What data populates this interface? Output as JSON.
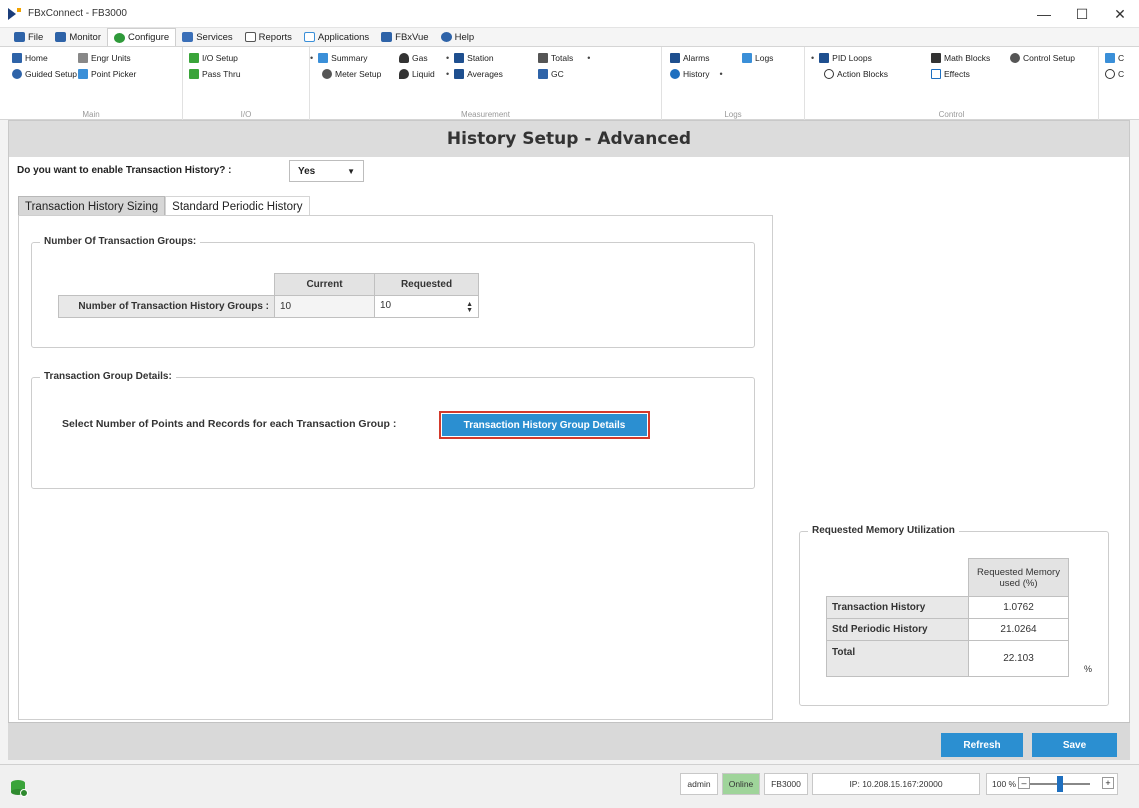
{
  "window": {
    "title": "FBxConnect - FB3000"
  },
  "menu": {
    "tabs": [
      {
        "label": "File",
        "color": "#2e63a8"
      },
      {
        "label": "Monitor",
        "color": "#2e63a8"
      },
      {
        "label": "Configure",
        "color": "#2f9a3a"
      },
      {
        "label": "Services",
        "color": "#3a6fb8"
      },
      {
        "label": "Reports",
        "color": "#555555"
      },
      {
        "label": "Applications",
        "color": "#3a8fd8"
      },
      {
        "label": "FBxVue",
        "color": "#2e63a8"
      },
      {
        "label": "Help",
        "color": "#2e63a8"
      }
    ],
    "active_index": 2
  },
  "ribbon": {
    "main": {
      "label": "Main",
      "items": [
        "Home",
        "Engr Units",
        "Guided Setup",
        "Point Picker"
      ]
    },
    "io": {
      "label": "I/O",
      "items": [
        "I/O Setup",
        "Pass Thru"
      ]
    },
    "measurement": {
      "label": "Measurement",
      "items": [
        "Summary",
        "Meter Setup",
        "Gas",
        "Liquid",
        "Station",
        "Averages",
        "Totals",
        "GC"
      ]
    },
    "logs": {
      "label": "Logs",
      "items": [
        "Alarms",
        "History",
        "Logs"
      ]
    },
    "control": {
      "label": "Control",
      "items": [
        "PID Loops",
        "Action Blocks",
        "Math Blocks",
        "Effects",
        "Control Setup"
      ]
    },
    "overflow": [
      "C",
      "C"
    ]
  },
  "page": {
    "title": "History Setup - Advanced",
    "enable_question": "Do you want to enable Transaction History? :",
    "enable_value": "Yes",
    "tabs": [
      "Transaction History Sizing",
      "Standard Periodic History"
    ],
    "groups_box": {
      "legend": "Number Of Transaction Groups:",
      "col_current": "Current",
      "col_requested": "Requested",
      "row_label": "Number of Transaction History Groups :",
      "current": "10",
      "requested": "10"
    },
    "details_box": {
      "legend": "Transaction Group Details:",
      "prompt": "Select Number of Points and Records for each Transaction Group :",
      "button": "Transaction History Group Details"
    },
    "memory": {
      "legend": "Requested Memory Utilization",
      "col_header": "Requested Memory used (%)",
      "rows": [
        {
          "label": "Transaction History",
          "value": "1.0762"
        },
        {
          "label": "Std Periodic History",
          "value": "21.0264"
        },
        {
          "label": "Total",
          "value": "22.103"
        }
      ],
      "unit": "%"
    }
  },
  "footer": {
    "refresh": "Refresh",
    "save": "Save"
  },
  "status": {
    "user": "admin",
    "state": "Online",
    "device": "FB3000",
    "ip": "IP: 10.208.15.167:20000",
    "zoom": "100 %",
    "zoom_level": 0.5
  }
}
